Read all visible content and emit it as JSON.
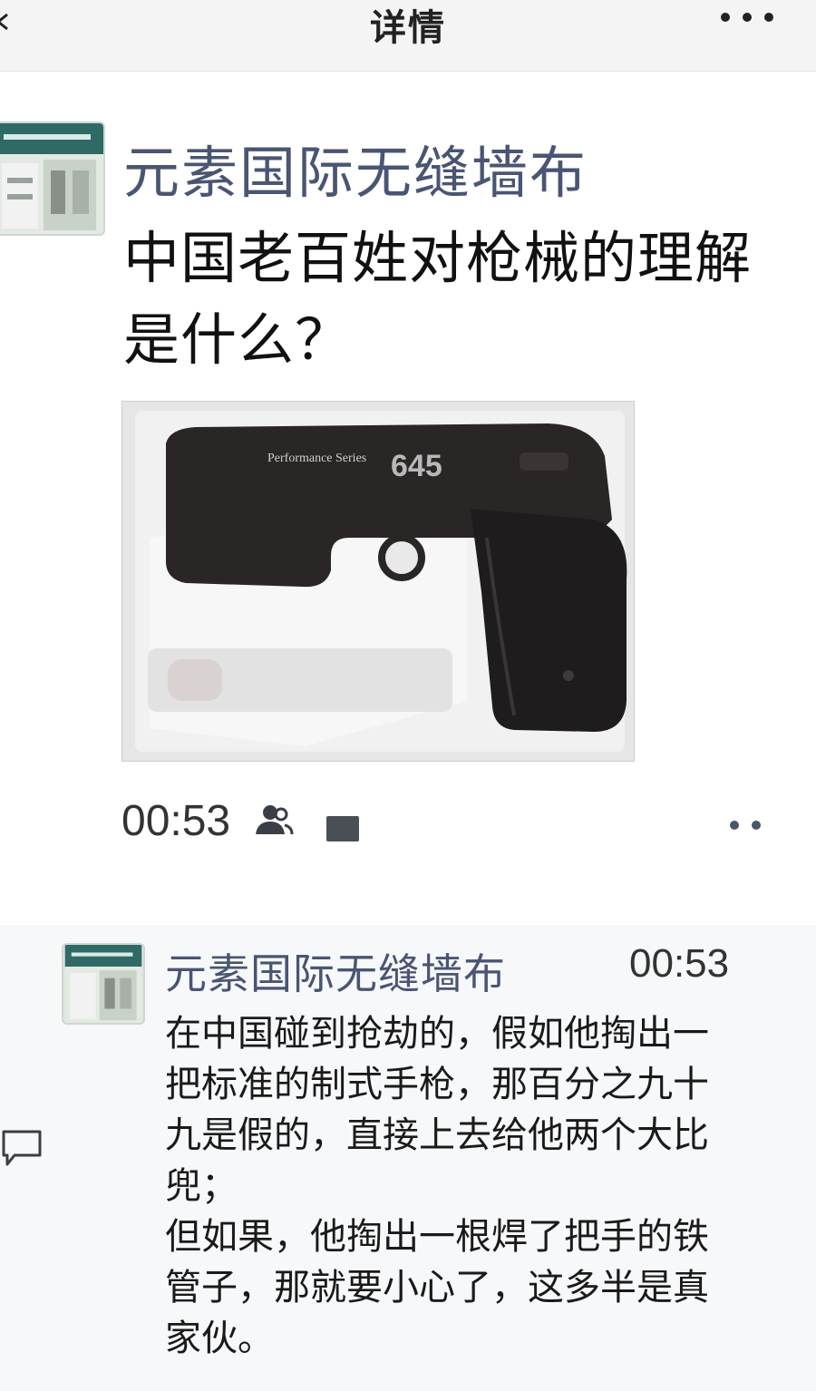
{
  "nav": {
    "title": "详情"
  },
  "post": {
    "author": "元素国际无缝墙布",
    "text": "中国老百姓对枪械的理解是什么？",
    "photo": {
      "engraving": "645",
      "brand_text": "Performance Series"
    },
    "time": "00:53"
  },
  "comment": {
    "author": "元素国际无缝墙布",
    "time": "00:53",
    "lines": [
      "在中国碰到抢劫的，假如他掏出一",
      "把标准的制式手枪，那百分之九十",
      "九是假的，直接上去给他两个大比",
      "兜；",
      "但如果，他掏出一根焊了把手的铁",
      "管子，那就要小心了，这多半是真",
      "家伙。"
    ]
  },
  "icons": {
    "back": "chevron-left-icon",
    "more": "more-dots-icon",
    "people": "people-icon",
    "comment": "comment-bubble-icon"
  },
  "colors": {
    "author": "#4a5573",
    "nav_bg": "#f4f4f4",
    "comment_bg": "#f6f8fa"
  }
}
